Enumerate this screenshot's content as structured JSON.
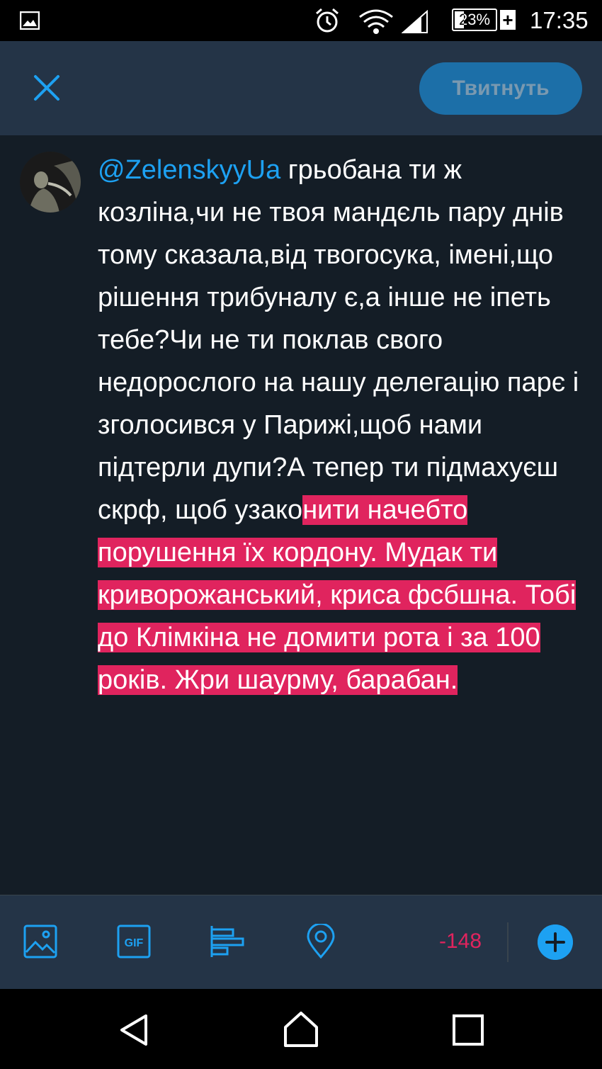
{
  "status_bar": {
    "battery_percent": "23%",
    "battery_level": 0.23,
    "time": "17:35",
    "icons": [
      "gallery-icon",
      "alarm-icon",
      "wifi-icon",
      "signal-icon",
      "battery-icon",
      "charging-icon"
    ]
  },
  "header": {
    "close_icon": "close-icon",
    "tweet_button": "Твитнуть"
  },
  "compose": {
    "mention": "@ZelenskyyUa",
    "text_plain": " грьобана ти ж козліна,чи не твоя мандєль пару днів тому сказала,від твогосука, імені,що рішення трибуналу є,а інше не іпеть тебе?Чи не ти поклав свого недорослого на нашу делегацію парє і зголосився у Парижі,щоб нами підтерли дупи?А тепер ти підмахуєш скрф, щоб узако",
    "text_overflow": "нити начебто порушення їх кордону.  Мудак ти криворожанський, криса фсбшна. Тобі до Клімкіна не домити рота і за 100 років.  Жри шаурму, барабан.  "
  },
  "bottom_toolbar": {
    "icons": [
      "image-icon",
      "gif-icon",
      "poll-icon",
      "location-icon",
      "add-tweet-icon"
    ],
    "char_counter": "-148",
    "accent": "#1da1f2",
    "overflow_color": "#e0245e"
  },
  "nav_bar": {
    "icons": [
      "back-icon",
      "home-icon",
      "recents-icon"
    ]
  }
}
